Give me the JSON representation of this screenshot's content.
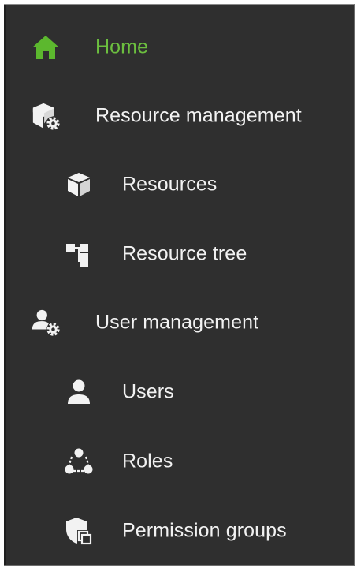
{
  "accent_color": "#6cbf3f",
  "text_color": "#f2f2f2",
  "background_color": "#2f2f2f",
  "nav": {
    "items": [
      {
        "label": "Home",
        "icon": "home-icon",
        "level": 0,
        "active": true
      },
      {
        "label": "Resource management",
        "icon": "resource-management-icon",
        "level": 0,
        "active": false
      },
      {
        "label": "Resources",
        "icon": "cube-icon",
        "level": 1,
        "active": false
      },
      {
        "label": "Resource tree",
        "icon": "tree-icon",
        "level": 1,
        "active": false
      },
      {
        "label": "User management",
        "icon": "user-management-icon",
        "level": 0,
        "active": false
      },
      {
        "label": "Users",
        "icon": "user-icon",
        "level": 1,
        "active": false
      },
      {
        "label": "Roles",
        "icon": "roles-icon",
        "level": 1,
        "active": false
      },
      {
        "label": "Permission groups",
        "icon": "permission-groups-icon",
        "level": 1,
        "active": false
      }
    ]
  }
}
